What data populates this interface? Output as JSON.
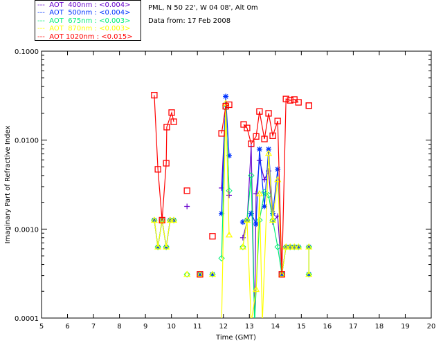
{
  "info": {
    "site": "PML, N 50 22', W 04 08', Alt 0m",
    "date": "Data from: 17 Feb 2008"
  },
  "legend": [
    {
      "dash": "---",
      "label": "AOT  400nm : <0.004>",
      "color": "#6600cc"
    },
    {
      "dash": "---",
      "label": "AOT  500nm : <0.004>",
      "color": "#0033ff"
    },
    {
      "dash": "---",
      "label": "AOT  675nm : <0.003>",
      "color": "#00ee77"
    },
    {
      "dash": "---",
      "label": "AOT  870nm : <0.003>",
      "color": "#ffff00"
    },
    {
      "dash": "---",
      "label": "AOT 1020nm : <0.015>",
      "color": "#ff0000"
    }
  ],
  "chart_data": {
    "type": "line",
    "xlabel": "Time (GMT)",
    "ylabel": "Imaginary Part of Refractive Index",
    "xlim": [
      5,
      20
    ],
    "ylim": [
      0.0001,
      0.1
    ],
    "yscale": "log",
    "xticks": [
      "5",
      "6",
      "7",
      "8",
      "9",
      "10",
      "11",
      "12",
      "13",
      "14",
      "15",
      "16",
      "17",
      "18",
      "19",
      "20"
    ],
    "yticks": [
      "0.0001",
      "0.0010",
      "0.0100",
      "0.1000"
    ],
    "grid": false,
    "legend_position": "top-left, outside",
    "series": [
      {
        "name": "AOT  400nm",
        "color": "#6600cc",
        "marker": "plus",
        "points": [
          [
            9.34,
            0.00126
          ],
          [
            9.48,
            0.00063
          ],
          [
            9.64,
            0.00126
          ],
          [
            9.8,
            0.00063
          ],
          [
            9.95,
            0.00126
          ],
          [
            10.09,
            0.00126
          ],
          null,
          [
            10.6,
            0.0018
          ],
          null,
          [
            11.1,
            0.00031
          ],
          null,
          [
            11.58,
            0.00031
          ],
          null,
          [
            11.93,
            0.0029
          ],
          [
            12.09,
            0.026
          ],
          [
            12.22,
            0.0024
          ],
          null,
          [
            12.75,
            0.0008
          ],
          [
            12.91,
            0.0012
          ],
          [
            13.07,
            0.0085
          ],
          [
            13.2,
            5e-05
          ],
          [
            13.26,
            0.0025
          ],
          [
            13.39,
            0.0059
          ],
          [
            13.58,
            0.0036
          ],
          [
            13.74,
            0.0045
          ],
          [
            13.9,
            0.0012
          ],
          [
            14.09,
            0.0014
          ],
          [
            14.25,
            0.00031
          ],
          [
            14.41,
            0.00063
          ],
          [
            14.57,
            0.00063
          ],
          [
            14.73,
            0.00063
          ],
          [
            14.89,
            0.00063
          ],
          null,
          [
            15.29,
            0.00063
          ],
          [
            15.29,
            0.00031
          ]
        ]
      },
      {
        "name": "AOT  500nm",
        "color": "#0033ff",
        "marker": "asterisk",
        "points": [
          [
            9.34,
            0.00126
          ],
          [
            9.48,
            0.00063
          ],
          [
            9.64,
            0.00126
          ],
          [
            9.8,
            0.00063
          ],
          [
            9.95,
            0.00126
          ],
          [
            10.09,
            0.00126
          ],
          null,
          [
            11.1,
            0.00031
          ],
          null,
          [
            11.58,
            0.00031
          ],
          null,
          [
            11.93,
            0.0015
          ],
          [
            12.09,
            0.031
          ],
          [
            12.22,
            0.0067
          ],
          null,
          [
            12.75,
            0.0012
          ],
          [
            12.91,
            0.00126
          ],
          [
            13.07,
            0.0015
          ],
          [
            13.26,
            0.00114
          ],
          [
            13.39,
            0.0079
          ],
          [
            13.58,
            0.0018
          ],
          [
            13.74,
            0.0079
          ],
          [
            13.9,
            0.0015
          ],
          [
            14.09,
            0.0047
          ],
          [
            14.25,
            0.00031
          ],
          [
            14.41,
            0.00063
          ],
          [
            14.57,
            0.00063
          ],
          [
            14.73,
            0.00063
          ],
          [
            14.89,
            0.00063
          ],
          null,
          [
            15.29,
            0.00063
          ],
          [
            15.29,
            0.00031
          ]
        ]
      },
      {
        "name": "AOT  675nm",
        "color": "#00ee77",
        "marker": "diamond",
        "points": [
          [
            9.34,
            0.00126
          ],
          [
            9.48,
            0.00063
          ],
          [
            9.64,
            0.00126
          ],
          [
            9.8,
            0.00063
          ],
          [
            9.95,
            0.00126
          ],
          [
            10.09,
            0.00126
          ],
          null,
          [
            10.6,
            0.00031
          ],
          null,
          [
            11.1,
            0.00031
          ],
          null,
          [
            11.58,
            0.00031
          ],
          null,
          [
            11.93,
            0.00047
          ],
          [
            12.09,
            0.023
          ],
          [
            12.22,
            0.0027
          ],
          null,
          [
            12.75,
            0.00063
          ],
          [
            12.91,
            0.00126
          ],
          [
            13.07,
            0.004
          ],
          [
            13.2,
            5e-05
          ],
          [
            13.39,
            0.00126
          ],
          [
            13.58,
            0.0026
          ],
          [
            13.74,
            0.0024
          ],
          [
            13.9,
            0.00126
          ],
          [
            14.09,
            0.00063
          ],
          [
            14.25,
            0.00031
          ],
          [
            14.41,
            0.00063
          ],
          [
            14.57,
            0.00063
          ],
          [
            14.73,
            0.00063
          ],
          [
            14.89,
            0.00063
          ],
          null,
          [
            15.29,
            0.00063
          ],
          [
            15.29,
            0.00031
          ]
        ]
      },
      {
        "name": "AOT  870nm",
        "color": "#ffff00",
        "marker": "triangle",
        "points": [
          [
            9.34,
            0.00126
          ],
          [
            9.48,
            0.00063
          ],
          [
            9.64,
            0.00126
          ],
          [
            9.8,
            0.00063
          ],
          [
            9.95,
            0.00126
          ],
          [
            10.09,
            0.00126
          ],
          null,
          [
            10.6,
            0.00031
          ],
          null,
          [
            11.1,
            0.00031
          ],
          null,
          [
            11.58,
            0.00031
          ],
          null,
          [
            11.93,
            5e-05
          ],
          [
            12.09,
            0.026
          ],
          [
            12.22,
            0.00086
          ],
          null,
          [
            12.75,
            0.00063
          ],
          [
            12.91,
            0.00126
          ],
          [
            13.07,
            5e-05
          ],
          [
            13.26,
            0.00021
          ],
          [
            13.39,
            0.0025
          ],
          [
            13.5,
            5e-05
          ],
          [
            13.74,
            0.0071
          ],
          [
            13.9,
            0.00126
          ],
          [
            14.09,
            0.0036
          ],
          [
            14.25,
            0.00031
          ],
          [
            14.41,
            0.00063
          ],
          [
            14.57,
            0.00063
          ],
          [
            14.73,
            0.00063
          ],
          [
            14.89,
            0.00063
          ],
          null,
          [
            15.29,
            0.00063
          ],
          [
            15.29,
            0.00031
          ]
        ]
      },
      {
        "name": "AOT 1020nm",
        "color": "#ff0000",
        "marker": "square",
        "points": [
          [
            9.34,
            0.032
          ],
          [
            9.48,
            0.0047
          ],
          [
            9.64,
            0.00126
          ],
          [
            9.8,
            0.0055
          ],
          [
            9.82,
            0.014
          ],
          [
            10.01,
            0.0204
          ],
          [
            10.09,
            0.0161
          ],
          null,
          [
            10.6,
            0.0027
          ],
          null,
          [
            11.1,
            0.00031
          ],
          null,
          [
            11.58,
            0.00083
          ],
          null,
          [
            11.93,
            0.0119
          ],
          [
            12.09,
            0.024
          ],
          [
            12.22,
            0.025
          ],
          null,
          [
            12.78,
            0.015
          ],
          [
            12.91,
            0.0137
          ],
          [
            13.07,
            0.0091
          ],
          [
            13.26,
            0.011
          ],
          [
            13.39,
            0.021
          ],
          [
            13.58,
            0.0103
          ],
          [
            13.74,
            0.02
          ],
          [
            13.9,
            0.0112
          ],
          [
            14.09,
            0.0164
          ],
          [
            14.25,
            0.00031
          ],
          [
            14.41,
            0.029
          ],
          [
            14.57,
            0.028
          ],
          [
            14.73,
            0.0286
          ],
          [
            14.89,
            0.0266
          ],
          null,
          [
            15.29,
            0.0244
          ],
          [
            15.29,
            0.0244
          ]
        ]
      }
    ]
  }
}
